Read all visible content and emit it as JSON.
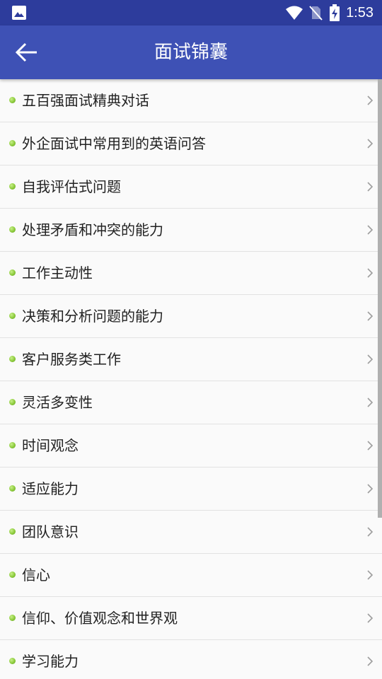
{
  "status_bar": {
    "time": "1:53"
  },
  "header": {
    "title": "面试锦囊"
  },
  "list": {
    "items": [
      {
        "label": "五百强面试精典对话"
      },
      {
        "label": "外企面试中常用到的英语问答"
      },
      {
        "label": "自我评估式问题"
      },
      {
        "label": "处理矛盾和冲突的能力"
      },
      {
        "label": "工作主动性"
      },
      {
        "label": "决策和分析问题的能力"
      },
      {
        "label": "客户服务类工作"
      },
      {
        "label": "灵活多变性"
      },
      {
        "label": "时间观念"
      },
      {
        "label": "适应能力"
      },
      {
        "label": "团队意识"
      },
      {
        "label": "信心"
      },
      {
        "label": "信仰、价值观念和世界观"
      },
      {
        "label": "学习能力"
      }
    ]
  },
  "colors": {
    "status_bar": "#2d3c9c",
    "app_bar": "#3e51b5",
    "bullet": "#8ccb3c"
  }
}
